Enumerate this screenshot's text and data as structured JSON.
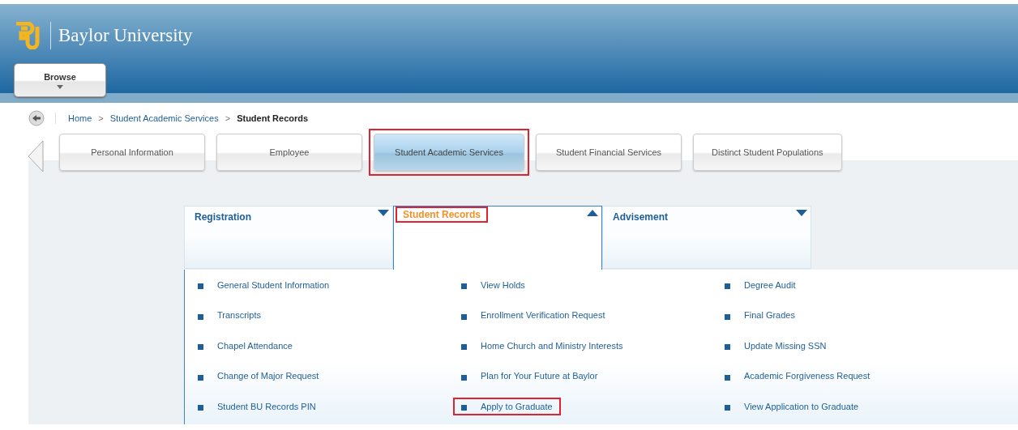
{
  "header": {
    "logo_text": "Baylor University",
    "browse_button": "Browse"
  },
  "breadcrumb": [
    {
      "label": "Home",
      "current": false
    },
    {
      "label": "Student Academic Services",
      "current": false
    },
    {
      "label": "Student Records",
      "current": true
    }
  ],
  "breadcrumb_separator": ">",
  "tabs": [
    {
      "label": "Personal Information",
      "selected": false,
      "highlighted": false
    },
    {
      "label": "Employee",
      "selected": false,
      "highlighted": false
    },
    {
      "label": "Student Academic Services",
      "selected": true,
      "highlighted": true
    },
    {
      "label": "Student Financial Services",
      "selected": false,
      "highlighted": false
    },
    {
      "label": "Distinct Student Populations",
      "selected": false,
      "highlighted": false
    }
  ],
  "sections": [
    {
      "label": "Registration",
      "expanded": false,
      "highlighted": false
    },
    {
      "label": "Student Records",
      "expanded": true,
      "highlighted": true
    },
    {
      "label": "Advisement",
      "expanded": false,
      "highlighted": false
    }
  ],
  "link_columns": [
    {
      "links": [
        {
          "label": "General Student Information",
          "highlighted": false
        },
        {
          "label": "Transcripts",
          "highlighted": false
        },
        {
          "label": "Chapel Attendance",
          "highlighted": false
        },
        {
          "label": "Change of Major Request",
          "highlighted": false
        },
        {
          "label": "Student BU Records PIN",
          "highlighted": false
        }
      ]
    },
    {
      "links": [
        {
          "label": "View Holds",
          "highlighted": false
        },
        {
          "label": "Enrollment Verification Request",
          "highlighted": false
        },
        {
          "label": "Home Church and Ministry Interests",
          "highlighted": false
        },
        {
          "label": "Plan for Your Future at Baylor",
          "highlighted": false
        },
        {
          "label": "Apply to Graduate",
          "highlighted": true
        }
      ]
    },
    {
      "links": [
        {
          "label": "Degree Audit",
          "highlighted": false
        },
        {
          "label": "Final Grades",
          "highlighted": false
        },
        {
          "label": "Update Missing SSN",
          "highlighted": false
        },
        {
          "label": "Academic Forgiveness Request",
          "highlighted": false
        },
        {
          "label": "View Application to Graduate",
          "highlighted": false
        }
      ]
    }
  ]
}
